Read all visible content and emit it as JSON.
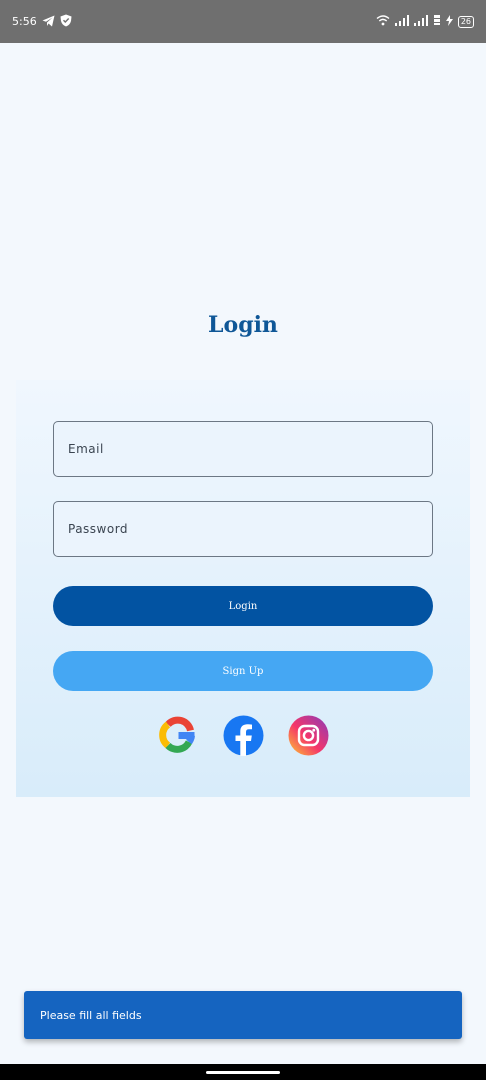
{
  "status_bar": {
    "time": "5:56",
    "battery": "26",
    "icons": [
      "telegram-icon",
      "shield-icon",
      "wifi-icon",
      "signal-icon",
      "signal-icon",
      "data-icon",
      "charging-icon",
      "battery-icon"
    ]
  },
  "page": {
    "title": "Login"
  },
  "form": {
    "email_placeholder": "Email",
    "password_placeholder": "Password",
    "login_label": "Login",
    "signup_label": "Sign Up"
  },
  "social": [
    "google-icon",
    "facebook-icon",
    "instagram-icon"
  ],
  "snackbar": {
    "message": "Please fill all fields"
  },
  "colors": {
    "primary": "#0253a2",
    "secondary": "#45a7f3",
    "title": "#0f5797",
    "snackbar": "#1564c0",
    "background": "#f3f8fd"
  }
}
